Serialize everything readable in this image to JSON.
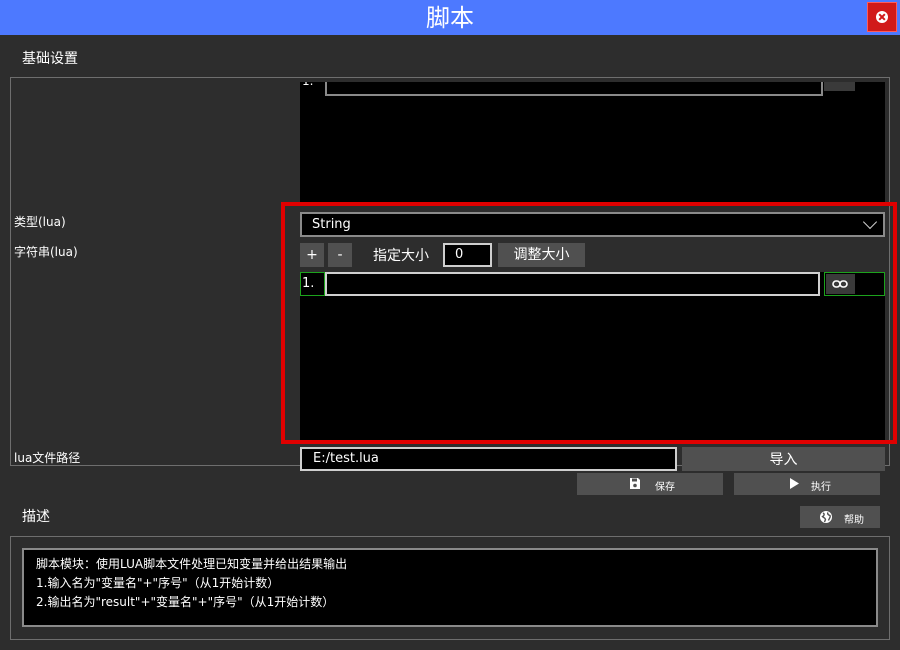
{
  "window": {
    "title": "脚本"
  },
  "sections": {
    "basic_settings": "基础设置",
    "description": "描述"
  },
  "labels": {
    "type": "类型(lua)",
    "string": "字符串(lua)",
    "lua_path": "lua文件路径"
  },
  "type_select": {
    "value": "String"
  },
  "size_controls": {
    "plus": "+",
    "minus": "-",
    "label": "指定大小",
    "value": "0",
    "resize_button": "调整大小"
  },
  "list": {
    "rows": [
      {
        "index": "1.",
        "value": ""
      }
    ]
  },
  "path": {
    "value": "E:/test.lua",
    "import_button": "导入"
  },
  "actions": {
    "save": "保存",
    "run": "执行",
    "help": "帮助"
  },
  "description_text": {
    "line1": "脚本模块：使用LUA脚本文件处理已知变量并给出结果输出",
    "line2": "1.输入名为\"变量名\"+\"序号\"（从1开始计数）",
    "line3": "2.输出名为\"result\"+\"变量名\"+\"序号\"（从1开始计数）"
  },
  "colors": {
    "title_bar": "#4d79ff",
    "close": "#d11a1a",
    "highlight": "#e00000",
    "active_border": "#1ca31c"
  },
  "icons": {
    "close": "close-icon",
    "chevron": "chevron-down-icon",
    "link": "link-icon",
    "save": "save-icon",
    "run": "play-icon",
    "help": "globe-icon"
  }
}
